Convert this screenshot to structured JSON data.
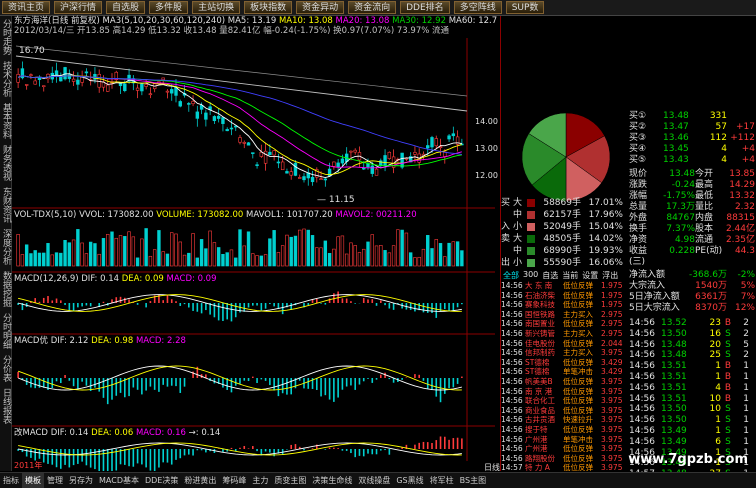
{
  "top_tabs": [
    "资讯主页",
    "沪深行情",
    "自选股",
    "多件股",
    "主站切换",
    "板块指数",
    "资金异动",
    "资金流向",
    "DDE排名",
    "多空阵线",
    "SUP数"
  ],
  "left_nav": [
    "分时走势",
    "技术分析",
    "基本资料",
    "财务透视",
    "东财资讯",
    "深度分析",
    "数据挖掘",
    "分时明细",
    "分价表",
    "日线报表"
  ],
  "stock_title": "东方海洋(日线 前复权)",
  "ma_line": {
    "label": "MA3(5,10,20,30,60,120,240)",
    "ma5": "MA5: 13.19",
    "ma10": "MA10: 13.08",
    "ma20": "MA20: 13.08",
    "ma30": "MA30: 12.92",
    "ma60": "MA60: 12.7"
  },
  "info_line": "2012/03/14/三 开13.85 高14.29 低13.32 收13.48 量82.41亿 幅-0.24(-1.75%) 换0.97(7.07%) 73.97% 流通",
  "price_labels": {
    "high": "16.70",
    "low": "11.15",
    "y1": "14.00",
    "y2": "13.00",
    "y3": "12.00"
  },
  "vol_line": {
    "label": "VOL-TDX(5,10)",
    "vvol": "VVOL: 173082.00",
    "volume": "VOLUME: 173082.00",
    "mavol1": "MAVOL1: 101707.20",
    "mavol2": "MAVOL2: 00211.20"
  },
  "macd1": {
    "label": "MACD(12,26,9)",
    "dif": "DIF: 0.14",
    "dea": "DEA: 0.09",
    "macd": "MACD: 0.09"
  },
  "macd2": {
    "label": "MACD优",
    "dif": "DIF: 2.12",
    "dea": "DEA: 0.98",
    "macd": "MACD: 2.28"
  },
  "macd3": {
    "label": "改MACD",
    "dif": "DIF: 0.14",
    "dea": "DEA: 0.06",
    "macd": "MACD: 0.16",
    "extra": "→: 0.14"
  },
  "bottom_date": "2011年",
  "bottom_label": "日线",
  "order_book": {
    "buy": [
      {
        "label": "买①",
        "price": "13.48",
        "vol": "331",
        "chg": ""
      },
      {
        "label": "买②",
        "price": "13.47",
        "vol": "57",
        "chg": "+17"
      },
      {
        "label": "买③",
        "price": "13.46",
        "vol": "112",
        "chg": "+112"
      },
      {
        "label": "买④",
        "price": "13.45",
        "vol": "4",
        "chg": "+4"
      },
      {
        "label": "买⑤",
        "price": "13.43",
        "vol": "4",
        "chg": "+4"
      }
    ]
  },
  "quote": [
    [
      "现价",
      "13.48",
      "今开",
      "13.85"
    ],
    [
      "涨跌",
      "-0.24",
      "最高",
      "14.29"
    ],
    [
      "涨幅",
      "-1.75%",
      "最低",
      "13.32"
    ],
    [
      "总量",
      "17.3万",
      "量比",
      "2.32"
    ],
    [
      "外盘",
      "84767",
      "内盘",
      "88315"
    ],
    [
      "换手",
      "7.37%",
      "股本",
      "2.44亿"
    ],
    [
      "净资",
      "4.98",
      "流通",
      "2.35亿"
    ],
    [
      "收益(三)",
      "0.228",
      "PE(动)",
      "44.3"
    ]
  ],
  "sell_table": [
    {
      "side": "买",
      "type": "大",
      "vol": "58869手",
      "pct": "17.01%"
    },
    {
      "side": "",
      "type": "中",
      "vol": "62157手",
      "pct": "17.96%"
    },
    {
      "side": "入",
      "type": "小",
      "vol": "52049手",
      "pct": "15.04%"
    },
    {
      "side": "卖",
      "type": "大",
      "vol": "48505手",
      "pct": "14.02%"
    },
    {
      "side": "",
      "type": "中",
      "vol": "68990手",
      "pct": "19.93%"
    },
    {
      "side": "出",
      "type": "小",
      "vol": "55590手",
      "pct": "16.06%"
    }
  ],
  "filter_tabs": [
    "全部",
    "300",
    "自选",
    "当前",
    "设置",
    "浮出"
  ],
  "flow": [
    [
      "净流入额",
      "-368.6万",
      "-2%"
    ],
    [
      "大宗流入",
      "1540万",
      "5%"
    ],
    [
      "5日净流入额",
      "6361万",
      "7%"
    ],
    [
      "5日大宗流入",
      "8370万",
      "12%"
    ]
  ],
  "news": [
    {
      "t": "14:56",
      "n": "大 东 南",
      "s": "低位反弹",
      "v": "1.975"
    },
    {
      "t": "14:56",
      "n": "石油济柴",
      "s": "低位反弹",
      "v": "1.975"
    },
    {
      "t": "14:56",
      "n": "赛象科技",
      "s": "低位反弹",
      "v": "1.975"
    },
    {
      "t": "14:56",
      "n": "国恒铁路",
      "s": "主力买入",
      "v": "2.975"
    },
    {
      "t": "14:56",
      "n": "南国置业",
      "s": "低位反弹",
      "v": "2.975"
    },
    {
      "t": "14:56",
      "n": "新兴铸管",
      "s": "主力买入",
      "v": "2.975"
    },
    {
      "t": "14:56",
      "n": "佳电股份",
      "s": "低位反弹",
      "v": "2.044"
    },
    {
      "t": "14:56",
      "n": "信邦制药",
      "s": "主力买入",
      "v": "3.975"
    },
    {
      "t": "14:56",
      "n": "ST德棉",
      "s": "低位反弹",
      "v": "3.429"
    },
    {
      "t": "14:56",
      "n": "ST德棉",
      "s": "单笔冲击",
      "v": "3.429"
    },
    {
      "t": "14:56",
      "n": "帆美美B",
      "s": "低位反弹",
      "v": "3.975"
    },
    {
      "t": "14:56",
      "n": "南 京 港",
      "s": "低位反弹",
      "v": "3.975"
    },
    {
      "t": "14:56",
      "n": "联合化工",
      "s": "低位反弹",
      "v": "3.975"
    },
    {
      "t": "14:56",
      "n": "商业食品",
      "s": "低位反弹",
      "v": "3.975"
    },
    {
      "t": "14:56",
      "n": "古井贡酒",
      "s": "快速拉升",
      "v": "3.975"
    },
    {
      "t": "14:56",
      "n": "搜于特",
      "s": "低位反弹",
      "v": "3.975"
    },
    {
      "t": "14:56",
      "n": "广州港",
      "s": "单笔冲击",
      "v": "3.975"
    },
    {
      "t": "14:56",
      "n": "广州港",
      "s": "低位反弹",
      "v": "3.975"
    },
    {
      "t": "14:56",
      "n": "路翔股份",
      "s": "低位反弹",
      "v": "3.975"
    },
    {
      "t": "14:57",
      "n": "特 力 A",
      "s": "低位反弹",
      "v": "3.975"
    },
    {
      "t": "14:57",
      "n": "路翔股份",
      "s": "低位反弹",
      "v": "3.975"
    }
  ],
  "ticks": [
    {
      "t": "14:56",
      "p": "13.52",
      "v": "23",
      "f": "B",
      "n": "2"
    },
    {
      "t": "14:56",
      "p": "13.50",
      "v": "16",
      "f": "S",
      "n": "2"
    },
    {
      "t": "14:56",
      "p": "13.48",
      "v": "20",
      "f": "S",
      "n": "5"
    },
    {
      "t": "14:56",
      "p": "13.48",
      "v": "25",
      "f": "S",
      "n": "2"
    },
    {
      "t": "14:56",
      "p": "13.51",
      "v": "1",
      "f": "B",
      "n": "1"
    },
    {
      "t": "14:56",
      "p": "13.51",
      "v": "1",
      "f": "B",
      "n": "1"
    },
    {
      "t": "14:56",
      "p": "13.51",
      "v": "4",
      "f": "B",
      "n": "1"
    },
    {
      "t": "14:56",
      "p": "13.51",
      "v": "10",
      "f": "B",
      "n": "1"
    },
    {
      "t": "14:56",
      "p": "13.50",
      "v": "10",
      "f": "S",
      "n": "1"
    },
    {
      "t": "14:56",
      "p": "13.50",
      "v": "1",
      "f": "S",
      "n": "1"
    },
    {
      "t": "14:56",
      "p": "13.49",
      "v": "1",
      "f": "S",
      "n": "1"
    },
    {
      "t": "14:56",
      "p": "13.49",
      "v": "6",
      "f": "S",
      "n": "1"
    },
    {
      "t": "14:56",
      "p": "13.49",
      "v": "1",
      "f": "S",
      "n": "1"
    },
    {
      "t": "14:56",
      "p": "13.48",
      "v": "1",
      "f": "S",
      "n": "1"
    },
    {
      "t": "14:57",
      "p": "13.48",
      "v": "27",
      "f": "S",
      "n": "1"
    }
  ],
  "bottom_tabs": [
    "指标",
    "模板",
    "管理",
    "另存为",
    "MACD基本",
    "DDE决策",
    "粉进黄出",
    "筹码峰",
    "主力",
    "质变主图",
    "决策生命线",
    "双线操盘",
    "GS黑线",
    "将军柱",
    "BS主图"
  ],
  "watermark": "www.7gpzb.com",
  "colors": {
    "up": "#ff3b3b",
    "down": "#00d0d0",
    "ma5": "#ffffff",
    "ma10": "#ffff00",
    "ma20": "#ff00ff",
    "ma30": "#00ff00",
    "ma60": "#4040ff"
  },
  "pie_data": {
    "buy_pct": [
      17.01,
      17.96,
      15.04
    ],
    "sell_pct": [
      14.02,
      19.93,
      16.06
    ]
  }
}
